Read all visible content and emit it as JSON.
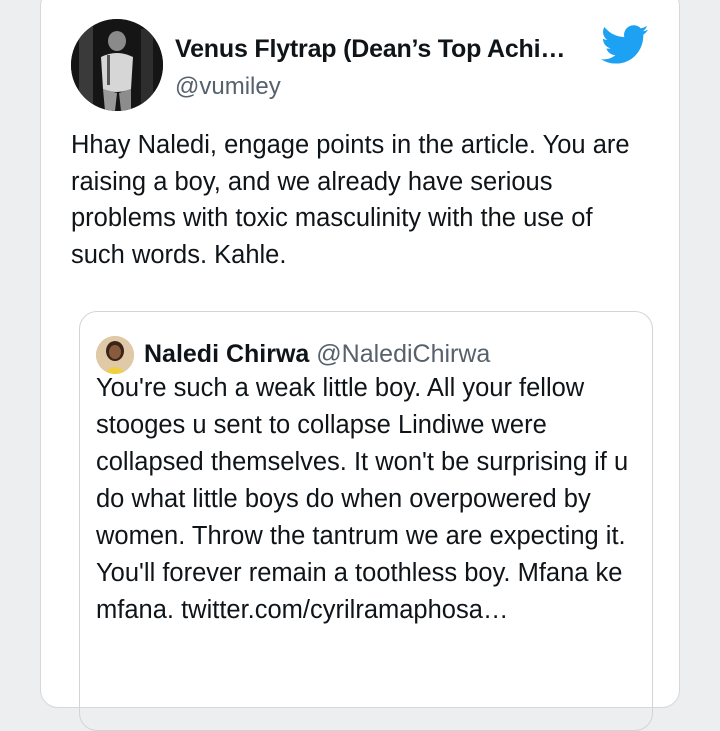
{
  "tweet": {
    "author_name": "Venus Flytrap (Dean’s Top Achi…",
    "author_handle": "@vumiley",
    "logo": "twitter-bird-icon",
    "text": "Hhay Naledi, engage points in the article. You are raising a boy, and we already have serious problems with toxic masculinity with the use of such words. Kahle."
  },
  "quoted": {
    "author_name": "Naledi Chirwa",
    "author_handle": "@NalediChirwa",
    "text": "You're such a weak little boy. All your fellow stooges u sent to collapse Lindiwe were collapsed themselves. It won't be surprising if u do what little boys do when overpowered by women. Throw the tantrum we are expecting it. You'll forever remain a toothless boy. Mfana ke mfana.",
    "link": "twitter.com/cyrilramaphosa…"
  },
  "colors": {
    "twitter_blue": "#1da1f2",
    "secondary_text": "#56616b",
    "border": "#cfd5da"
  }
}
